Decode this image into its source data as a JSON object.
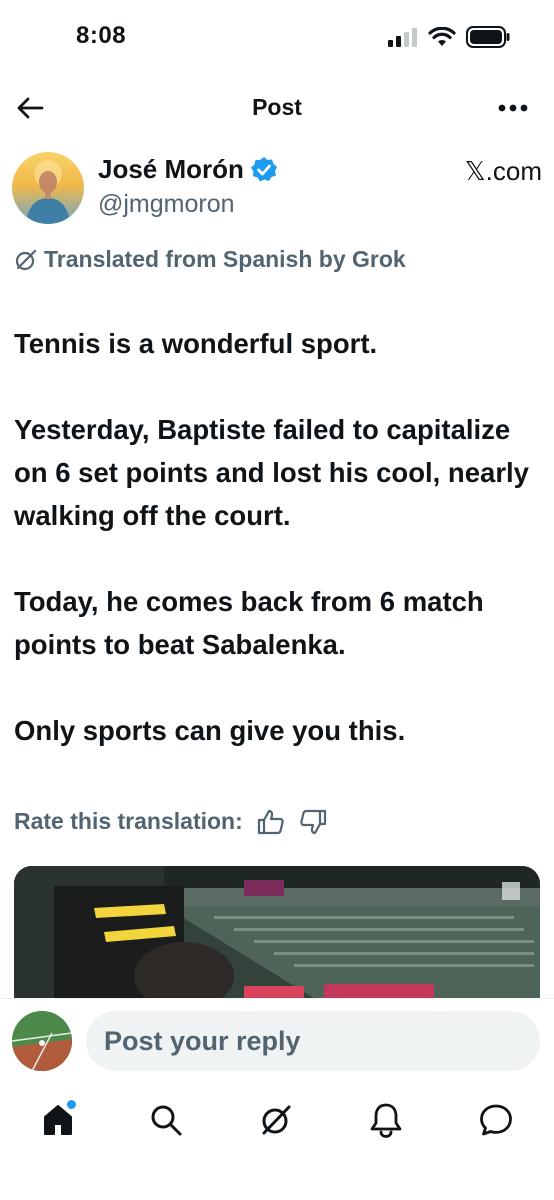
{
  "status_bar": {
    "time": "8:08"
  },
  "nav": {
    "title": "Post"
  },
  "author": {
    "name": "José Morón",
    "handle": "@jmgmoron",
    "verified": true,
    "source": "𝕏.com"
  },
  "translation": {
    "note": "Translated from Spanish by Grok",
    "rate_label": "Rate this translation:"
  },
  "post": {
    "paragraphs": [
      "Tennis is a wonderful sport.",
      "Yesterday, Baptiste failed to capitalize on 6 set points and lost his cool, nearly walking off the court.",
      "Today, he comes back from 6 match points to beat Sabalenka.",
      "Only sports can give you this."
    ]
  },
  "reply": {
    "placeholder": "Post your reply"
  },
  "tabs": [
    {
      "name": "home-icon",
      "active": true,
      "badge": true
    },
    {
      "name": "search-icon",
      "active": false
    },
    {
      "name": "grok-icon",
      "active": false
    },
    {
      "name": "notifications-icon",
      "active": false
    },
    {
      "name": "messages-icon",
      "active": false
    }
  ],
  "colors": {
    "text": "#0f1419",
    "secondary": "#536471",
    "accent": "#1d9bf0",
    "input_bg": "#eff3f4"
  }
}
